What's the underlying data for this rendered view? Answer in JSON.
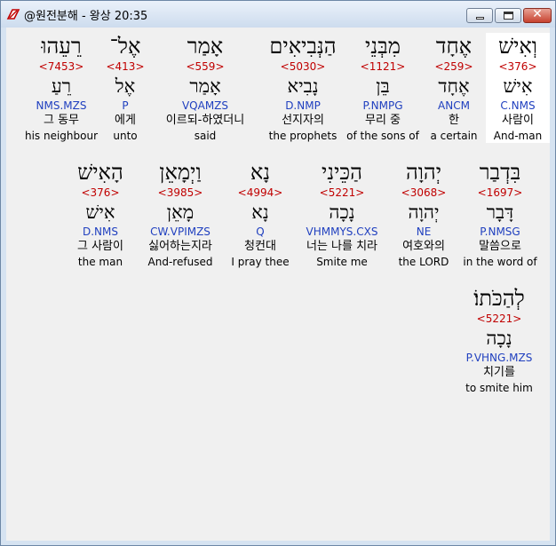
{
  "window": {
    "title": "@원전분해 - 왕상 20:35"
  },
  "words": [
    {
      "hebrew": "וְאִישׁ",
      "strong": "<376>",
      "lemma": "אִישׁ",
      "parse": "C.NMS",
      "korean": "사람이",
      "english": "And-man"
    },
    {
      "hebrew": "אֶחָד",
      "strong": "<259>",
      "lemma": "אֶחָד",
      "parse": "ANCM",
      "korean": "한",
      "english": "a certain"
    },
    {
      "hebrew": "מִבְּנֵי",
      "strong": "<1121>",
      "lemma": "בֵּן",
      "parse": "P.NMPG",
      "korean": "무리 중",
      "english": "of the sons of"
    },
    {
      "hebrew": "הַנְּבִיאִים",
      "strong": "<5030>",
      "lemma": "נָבִיא",
      "parse": "D.NMP",
      "korean": "선지자의",
      "english": "the prophets"
    },
    {
      "hebrew": "אָמַר",
      "strong": "<559>",
      "lemma": "אָמַר",
      "parse": "VQAMZS",
      "korean": "이르되-하였더니",
      "english": "said"
    },
    {
      "hebrew": "אֶל־",
      "strong": "<413>",
      "lemma": "אֶל",
      "parse": "P",
      "korean": "에게",
      "english": "unto"
    },
    {
      "hebrew": "רֵעֵהוּ",
      "strong": "<7453>",
      "lemma": "רֵעַ",
      "parse": "NMS.MZS",
      "korean": "그 동무",
      "english": "his neighbour"
    },
    {
      "hebrew": "בִּדְבַר",
      "strong": "<1697>",
      "lemma": "דָּבָר",
      "parse": "P.NMSG",
      "korean": "말씀으로",
      "english": "in the word of"
    },
    {
      "hebrew": "יְהוָה",
      "strong": "<3068>",
      "lemma": "יְהוָה",
      "parse": "NE",
      "korean": "여호와의",
      "english": "the LORD"
    },
    {
      "hebrew": "הַכֵּינִי",
      "strong": "<5221>",
      "lemma": "נָכָה",
      "parse": "VHMMYS.CXS",
      "korean": "너는 나를 치라",
      "english": "Smite me"
    },
    {
      "hebrew": "נָא",
      "strong": "<4994>",
      "lemma": "נָא",
      "parse": "Q",
      "korean": "청컨대",
      "english": "I pray thee"
    },
    {
      "hebrew": "וַיְמָאֵן",
      "strong": "<3985>",
      "lemma": "מָאֵן",
      "parse": "CW.VPIMZS",
      "korean": "싫어하는지라",
      "english": "And-refused"
    },
    {
      "hebrew": "הָאִישׁ",
      "strong": "<376>",
      "lemma": "אִישׁ",
      "parse": "D.NMS",
      "korean": "그 사람이",
      "english": "the man"
    },
    {
      "hebrew": "לְהַכֹּתוֹ׃",
      "strong": "<5221>",
      "lemma": "נָכָה",
      "parse": "P.VHNG.MZS",
      "korean": "치기를",
      "english": "to smite him"
    }
  ]
}
